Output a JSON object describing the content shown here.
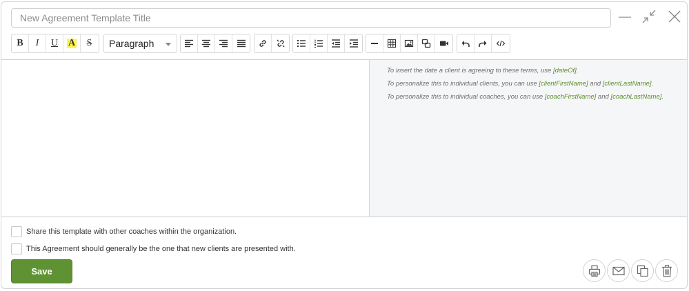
{
  "title_input": {
    "placeholder": "New Agreement Template Title",
    "value": ""
  },
  "window_controls": [
    "minimize-icon",
    "compress-icon",
    "close-icon"
  ],
  "toolbar": {
    "bold_label": "B",
    "italic_label": "I",
    "underline_label": "U",
    "highlight_label": "A",
    "strike_label": "S",
    "paragraph_select": "Paragraph",
    "highlight_color": "#fff44f"
  },
  "hints": {
    "line1": {
      "prefix": "To insert the date a client is agreeing to these terms, use ",
      "tag1": "[dateOf]",
      "suffix": "."
    },
    "line2": {
      "prefix": "To personalize this to individual clients, you can use ",
      "tag1": "[clientFirstName]",
      "middle": " and ",
      "tag2": "[clientLastName]",
      "suffix": "."
    },
    "line3": {
      "prefix": "To personalize this to individual coaches, you can use ",
      "tag1": "[coachFirstName]",
      "middle": " and ",
      "tag2": "[coachLastName]",
      "suffix": "."
    }
  },
  "options": {
    "share_label": "Share this template with other coaches within the organization.",
    "share_checked": false,
    "default_label": "This Agreement should generally be the one that new clients are presented with.",
    "default_checked": false
  },
  "actions": {
    "save_label": "Save"
  },
  "colors": {
    "accent": "#5f9233",
    "tag": "#5a8d2a",
    "hint_background": "#f5f6f7"
  }
}
